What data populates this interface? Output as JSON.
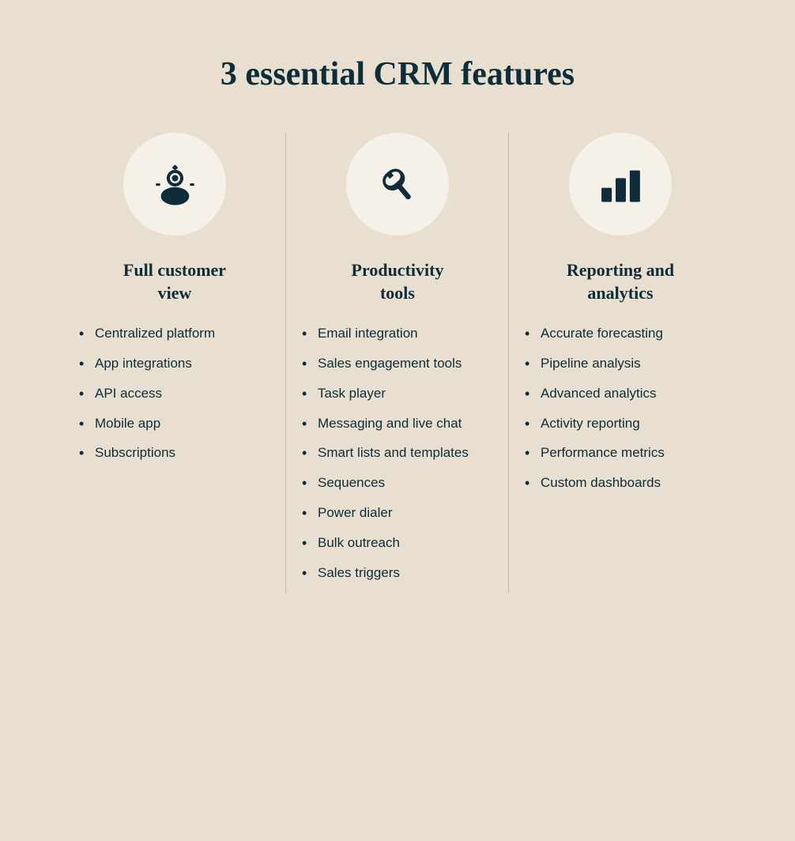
{
  "page": {
    "title": "3 essential CRM features",
    "background_color": "#e8dfd0"
  },
  "columns": [
    {
      "id": "full-customer-view",
      "icon": "person-icon",
      "title": "Full customer\nview",
      "items": [
        "Centralized platform",
        "App integrations",
        "API access",
        "Mobile app",
        "Subscriptions"
      ]
    },
    {
      "id": "productivity-tools",
      "icon": "wrench-icon",
      "title": "Productivity\ntools",
      "items": [
        "Email integration",
        "Sales engagement tools",
        "Task player",
        "Messaging and live chat",
        "Smart lists and templates",
        "Sequences",
        "Power dialer",
        "Bulk outreach",
        "Sales triggers"
      ]
    },
    {
      "id": "reporting-analytics",
      "icon": "chart-icon",
      "title": "Reporting and\nanalytics",
      "items": [
        "Accurate forecasting",
        "Pipeline analysis",
        "Advanced analytics",
        "Activity reporting",
        "Performance metrics",
        "Custom dashboards"
      ]
    }
  ]
}
